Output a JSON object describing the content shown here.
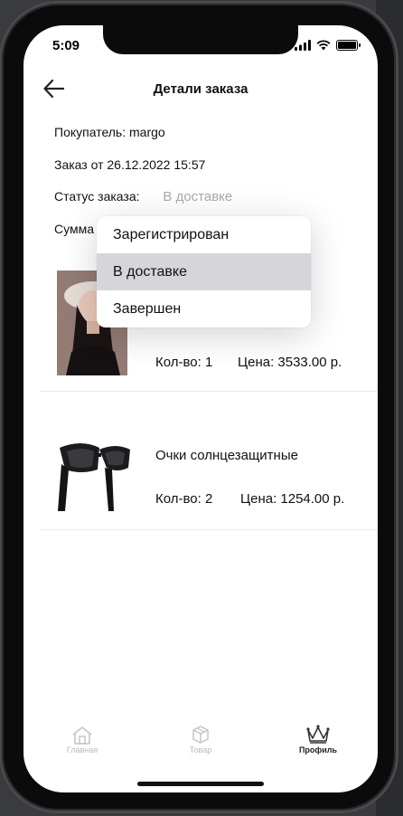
{
  "status_bar": {
    "time": "5:09"
  },
  "header": {
    "title": "Детали заказа"
  },
  "order": {
    "buyer": "Покупатель: margo",
    "date": "Заказ от 26.12.2022 15:57",
    "status_label": "Статус заказа:",
    "status_value": "В доставке",
    "sum_label": "Сумма"
  },
  "dropdown": {
    "options": [
      "Зарегистрирован",
      "В доставке",
      "Завершен"
    ],
    "selected": "В доставке"
  },
  "items": [
    {
      "name": "",
      "qty": "Кол-во: 1",
      "price": "Цена: 3533.00 р.",
      "image": "woman-in-hat-photo"
    },
    {
      "name": "Очки солнцезащитные",
      "qty": "Кол-во: 2",
      "price": "Цена: 1254.00 р.",
      "image": "sunglasses-photo"
    }
  ],
  "tabbar": {
    "tabs": [
      {
        "label": "Главная",
        "icon": "home-icon",
        "active": false
      },
      {
        "label": "Товар",
        "icon": "box-icon",
        "active": false
      },
      {
        "label": "Профиль",
        "icon": "crown-icon",
        "active": true
      }
    ]
  },
  "colors": {
    "status_value": "#aaaaaa",
    "selected_option_bg": "#d6d6da",
    "inactive_tab": "#b9b9b9"
  }
}
